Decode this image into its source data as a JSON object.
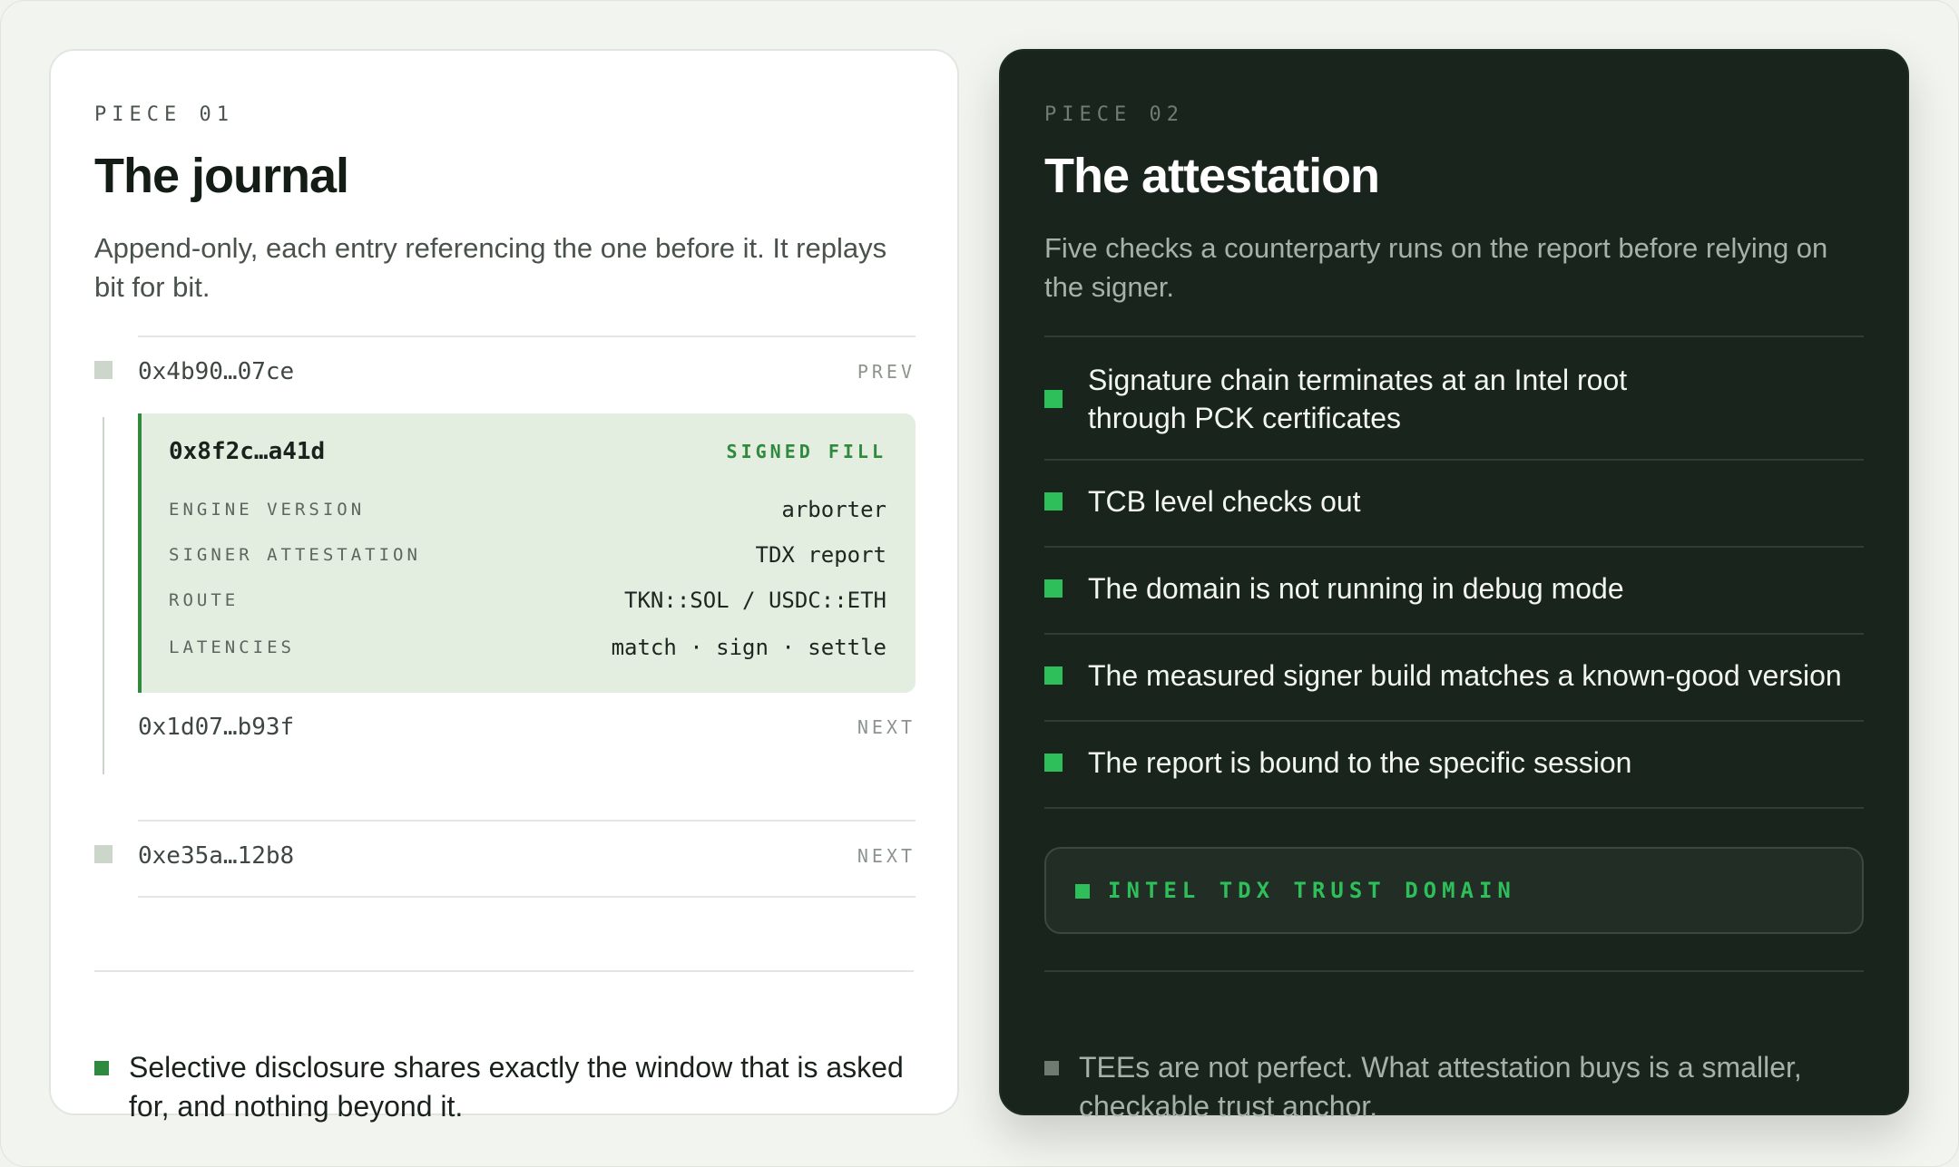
{
  "piece1": {
    "eyebrow": "PIECE 01",
    "title": "The journal",
    "description": "Append-only, each entry referencing the one before it. It replays bit for bit.",
    "entries": [
      {
        "hash": "0x4b90…07ce",
        "tag": "PREV"
      },
      {
        "hash": "0x1d07…b93f",
        "tag": "NEXT"
      },
      {
        "hash": "0xe35a…12b8",
        "tag": "NEXT"
      }
    ],
    "fill": {
      "hash": "0x8f2c…a41d",
      "tag": "SIGNED FILL",
      "rows": [
        {
          "key": "ENGINE VERSION",
          "value": "arborter"
        },
        {
          "key": "SIGNER ATTESTATION",
          "value": "TDX report"
        },
        {
          "key": "ROUTE",
          "value": "TKN::SOL / USDC::ETH"
        },
        {
          "key": "LATENCIES",
          "value": "match · sign · settle"
        }
      ]
    },
    "footnote": "Selective disclosure shares exactly the window that is asked for, and nothing beyond it."
  },
  "piece2": {
    "eyebrow": "PIECE 02",
    "title": "The attestation",
    "description": "Five checks a counterparty runs on the report before relying on the signer.",
    "checks": [
      "Signature chain terminates at an Intel root through PCK certificates",
      "TCB level checks out",
      "The domain is not running in debug mode",
      "The measured signer build matches a known-good version",
      "The report is bound to the specific session"
    ],
    "badge": "INTEL TDX TRUST DOMAIN",
    "footnote": "TEEs are not perfect. What attestation buys is a smaller, checkable trust anchor."
  },
  "colors": {
    "accent_green": "#2f8a3e",
    "check_green": "#2fbf5a",
    "dark_card": "#19241c",
    "fill_bg": "#e3ede0"
  }
}
